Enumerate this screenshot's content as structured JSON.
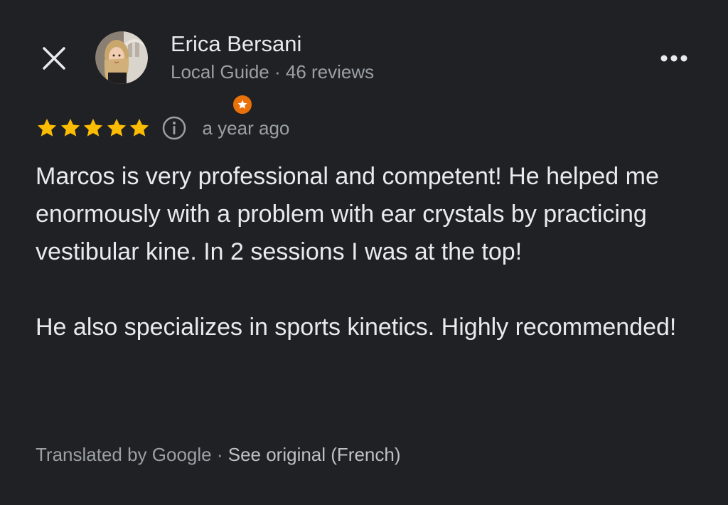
{
  "header": {
    "close_icon": "close-icon",
    "more_icon": "more-horizontal-icon",
    "author": {
      "name": "Erica Bersani",
      "role": "Local Guide",
      "separator": " · ",
      "reviews": "46 reviews",
      "badge_icon": "local-guide-star-icon"
    }
  },
  "review": {
    "rating": 5,
    "rating_max": 5,
    "star_color": "#fbbc04",
    "info_icon": "info-icon",
    "time_ago": "a year ago",
    "paragraph_1": "Marcos is very professional and competent! He helped me enormously with a problem with ear crystals by practicing vestibular kine. In 2 sessions I was at the top!",
    "paragraph_2": "He also specializes in sports kinetics. Highly recommended!"
  },
  "translation": {
    "label": "Translated by Google",
    "separator": " · ",
    "link": "See original (French)"
  },
  "colors": {
    "background": "#202124",
    "badge": "#e8710a",
    "secondary_text": "#9aa0a6"
  }
}
